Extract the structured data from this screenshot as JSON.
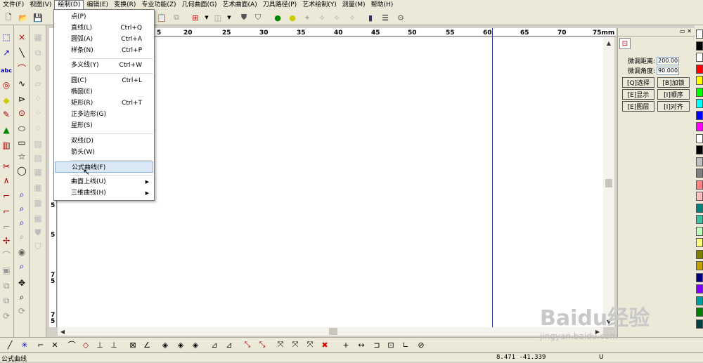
{
  "menubar": {
    "items": [
      {
        "label": "文件(F)"
      },
      {
        "label": "视图(V)"
      },
      {
        "label": "绘制(D)"
      },
      {
        "label": "编辑(E)"
      },
      {
        "label": "变换(R)"
      },
      {
        "label": "专业功能(Z)"
      },
      {
        "label": "几何曲面(G)"
      },
      {
        "label": "艺术曲面(A)"
      },
      {
        "label": "刀具路径(P)"
      },
      {
        "label": "艺术绘制(Y)"
      },
      {
        "label": "测量(M)"
      },
      {
        "label": "帮助(H)"
      }
    ]
  },
  "draw_menu": {
    "items": [
      {
        "label": "点(P)",
        "shortcut": ""
      },
      {
        "label": "直线(L)",
        "shortcut": "Ctrl+Q"
      },
      {
        "label": "圆弧(A)",
        "shortcut": "Ctrl+A"
      },
      {
        "label": "样条(N)",
        "shortcut": "Ctrl+P"
      },
      {
        "label": "多义线(Y)",
        "shortcut": "Ctrl+W"
      },
      {
        "label": "圆(C)",
        "shortcut": "Ctrl+L"
      },
      {
        "label": "椭圆(E)",
        "shortcut": ""
      },
      {
        "label": "矩形(R)",
        "shortcut": "Ctrl+T"
      },
      {
        "label": "正多边形(G)",
        "shortcut": ""
      },
      {
        "label": "星形(S)",
        "shortcut": ""
      },
      {
        "label": "双线(D)",
        "shortcut": ""
      },
      {
        "label": "箭头(W)",
        "shortcut": ""
      },
      {
        "label": "公式曲线(F)",
        "shortcut": ""
      },
      {
        "label": "曲面上线(U)",
        "shortcut": ""
      },
      {
        "label": "三维曲线(H)",
        "shortcut": ""
      }
    ],
    "highlighted": "公式曲线(F)"
  },
  "hruler": {
    "ticks": [
      "5",
      "20",
      "25",
      "30",
      "35",
      "40",
      "45",
      "50",
      "55",
      "60",
      "65",
      "70",
      "75mm"
    ]
  },
  "vruler": {
    "ticks": [
      "5",
      "5",
      "7 5",
      "7 5"
    ]
  },
  "right_panel": {
    "fine_distance_label": "微调距离:",
    "fine_distance_value": "200.00",
    "fine_angle_label": "微调角度:",
    "fine_angle_value": "90.000",
    "buttons": [
      "[Q]选择",
      "[B]加锁",
      "[E]显示",
      "[I]顺序",
      "[E]图层",
      "[I]对齐"
    ]
  },
  "palette": {
    "colors": [
      "#ffffff",
      "#000000",
      "#ffffff",
      "#ff0000",
      "#ffff00",
      "#00ff00",
      "#00ffff",
      "#0000ff",
      "#ff00ff",
      "#ffffff",
      "#000000",
      "#c0c0c0",
      "#808080",
      "#ff8080",
      "#ffc0c0",
      "#008080",
      "#40c0a0",
      "#c0ffc0",
      "#ffff80",
      "#808000",
      "#c0a000",
      "#000080",
      "#8000ff",
      "#00a0a0",
      "#008000",
      "#004040"
    ]
  },
  "status": {
    "left_text": "公式曲线",
    "coords": "8.471  -41.339",
    "indicator": "U"
  },
  "watermark": {
    "text": "Baidu经验",
    "url": "jingyan.baidu.com"
  }
}
